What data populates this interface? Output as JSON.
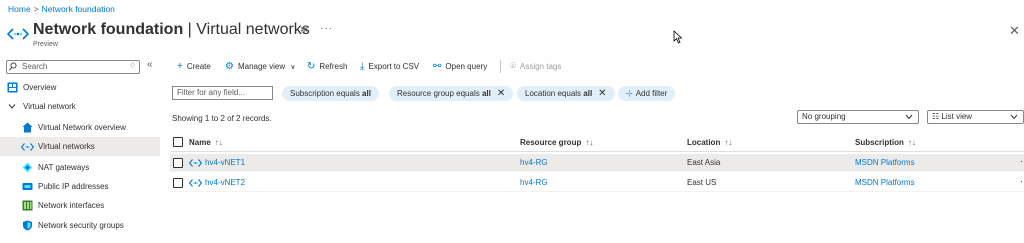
{
  "breadcrumb": {
    "home": "Home",
    "sep": ">",
    "current": "Network foundation"
  },
  "header": {
    "title_bold": "Network foundation",
    "title_rest": " | Virtual networks",
    "subtitle": "Preview",
    "pin_glyph": "✲",
    "more_glyph": "···",
    "close_glyph": "✕"
  },
  "sidebar": {
    "search_placeholder": "Search",
    "collapse_glyph": "«",
    "settings_glyph": "♢",
    "items": [
      {
        "label": "Overview",
        "icon": "overview-icon"
      },
      {
        "label": "Virtual network",
        "icon": "chevron-down-icon"
      },
      {
        "label": "Virtual Network overview",
        "icon": "network-overview-icon"
      },
      {
        "label": "Virtual networks",
        "icon": "vnet-icon"
      },
      {
        "label": "NAT gateways",
        "icon": "nat-gateway-icon"
      },
      {
        "label": "Public IP addresses",
        "icon": "public-ip-icon"
      },
      {
        "label": "Network interfaces",
        "icon": "network-interface-icon"
      },
      {
        "label": "Network security groups",
        "icon": "nsg-icon"
      }
    ]
  },
  "toolbar": {
    "create": "Create",
    "manage_view": "Manage view",
    "manage_view_chevron": "∨",
    "refresh": "Refresh",
    "export_csv": "Export to CSV",
    "open_query": "Open query",
    "assign_tags": "Assign tags"
  },
  "filters": {
    "input_placeholder": "Filter for any field...",
    "pills": [
      {
        "text": "Subscription equals ",
        "value": "all",
        "removable": false
      },
      {
        "text": "Resource group equals ",
        "value": "all",
        "removable": true
      },
      {
        "text": "Location equals ",
        "value": "all",
        "removable": true
      }
    ],
    "add_filter": "Add filter",
    "remove_glyph": "✕"
  },
  "records_text": "Showing 1 to 2 of 2 records.",
  "grouping": {
    "value": "No grouping"
  },
  "view": {
    "value": "List view",
    "prefix_glyph": "☷"
  },
  "table": {
    "columns": [
      {
        "label": "Name",
        "sort": "↑↓"
      },
      {
        "label": "Resource group",
        "sort": "↑↓"
      },
      {
        "label": "Location",
        "sort": "↑↓"
      },
      {
        "label": "Subscription",
        "sort": "↑↓"
      }
    ],
    "rows": [
      {
        "name": "hv4-vNET1",
        "resource_group": "hv4-RG",
        "location": "East Asia",
        "subscription": "MSDN Platforms",
        "highlighted": true
      },
      {
        "name": "hv4-vNET2",
        "resource_group": "hv4-RG",
        "location": "East US",
        "subscription": "MSDN Platforms",
        "highlighted": false
      }
    ],
    "row_more_glyph": "···"
  },
  "colors": {
    "accent": "#0078d4",
    "pill_bg": "#e1effa",
    "selected_bg": "#edebe9"
  }
}
